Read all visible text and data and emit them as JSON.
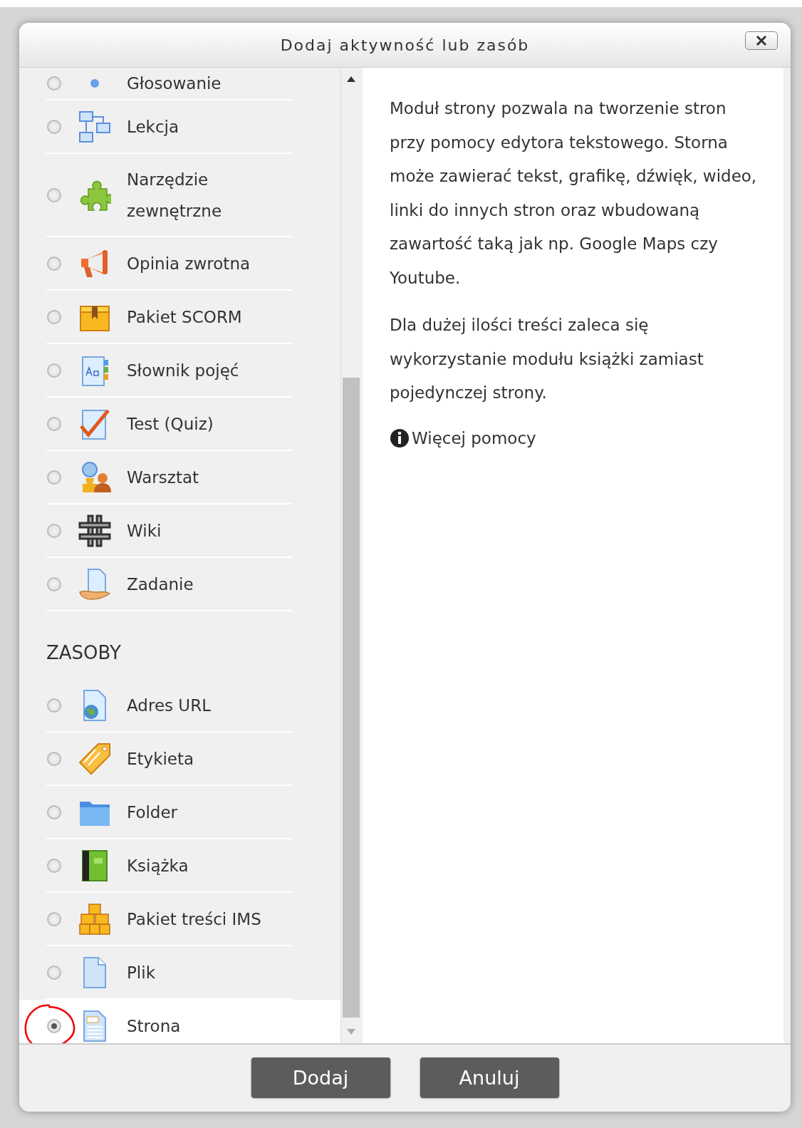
{
  "dialog": {
    "title": "Dodaj aktywność lub zasób"
  },
  "activities": [
    {
      "label": "Głosowanie",
      "selected": false
    },
    {
      "label": "Lekcja",
      "selected": false
    },
    {
      "label": "Narzędzie zewnętrzne",
      "selected": false
    },
    {
      "label": "Opinia zwrotna",
      "selected": false
    },
    {
      "label": "Pakiet SCORM",
      "selected": false
    },
    {
      "label": "Słownik pojęć",
      "selected": false
    },
    {
      "label": "Test (Quiz)",
      "selected": false
    },
    {
      "label": "Warsztat",
      "selected": false
    },
    {
      "label": "Wiki",
      "selected": false
    },
    {
      "label": "Zadanie",
      "selected": false
    }
  ],
  "resources": {
    "heading": "ZASOBY",
    "items": [
      {
        "label": "Adres URL",
        "selected": false
      },
      {
        "label": "Etykieta",
        "selected": false
      },
      {
        "label": "Folder",
        "selected": false
      },
      {
        "label": "Książka",
        "selected": false
      },
      {
        "label": "Pakiet treści IMS",
        "selected": false
      },
      {
        "label": "Plik",
        "selected": false
      },
      {
        "label": "Strona",
        "selected": true
      }
    ]
  },
  "description": {
    "paragraphs": [
      "Moduł strony pozwala na tworzenie stron przy pomocy edytora tekstowego. Storna może zawierać tekst, grafikę, dźwięk, wideo, linki do innych stron oraz wbudowaną zawartość taką jak np. Google Maps czy Youtube.",
      "Dla dużej ilości treści zaleca się wykorzystanie modułu książki zamiast pojedynczej strony."
    ],
    "help_link": "Więcej pomocy"
  },
  "buttons": [
    "Dodaj",
    "Anuluj"
  ]
}
